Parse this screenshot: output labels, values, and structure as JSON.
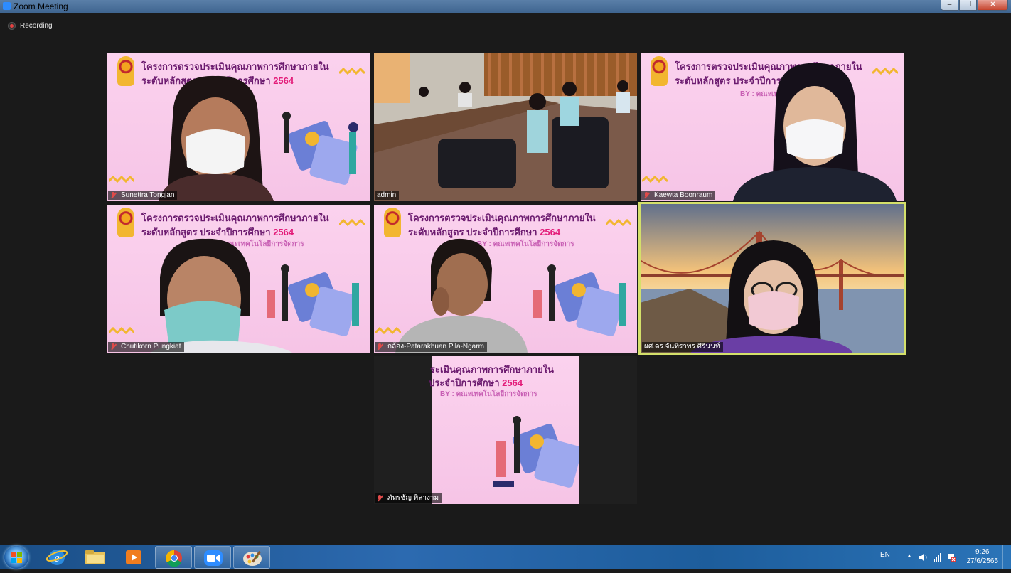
{
  "window": {
    "title": "Zoom Meeting",
    "controls": [
      "minimize",
      "maximize",
      "close"
    ]
  },
  "meeting": {
    "recording_label": "Recording",
    "slide": {
      "line1": "โครงการตรวจประเมินคุณภาพการศึกษาภายใน",
      "line2": "ระดับหลักสูตร ประจำปีการศึกษา ",
      "year": "2564",
      "by": "BY : คณะเทคโนโลยีการจัดการ",
      "cropped_line1": "ระเมินคุณภาพการศึกษาภายใน",
      "cropped_line2": " ประจำปีการศึกษา "
    },
    "participants": [
      {
        "name": "Sunettra Tongjan",
        "muted": true
      },
      {
        "name": "admin",
        "muted": false
      },
      {
        "name": "Kaewta Boonraum",
        "muted": true
      },
      {
        "name": "Chutikorn Pungkiat",
        "muted": true
      },
      {
        "name": "กล้อง-Patarakhuan Pila-Ngarm",
        "muted": true
      },
      {
        "name": "ผศ.ดร.จันทิราพร ศิรินนท์",
        "muted": false,
        "active_speaker": true
      },
      {
        "name": "ภัทรชัญ  พิลางาม",
        "muted": true
      }
    ]
  },
  "taskbar": {
    "pinned": [
      "windows-start",
      "internet-explorer",
      "file-explorer",
      "media-player",
      "chrome",
      "zoom",
      "paint"
    ],
    "language": "EN",
    "time": "9:26",
    "date": "27/6/2565"
  },
  "colors": {
    "slide_pink": "#f8c8e8",
    "title_purple": "#6b1b6f",
    "year_magenta": "#e31c79",
    "active_border": "#d4e06a",
    "recording_red": "#e34141"
  }
}
